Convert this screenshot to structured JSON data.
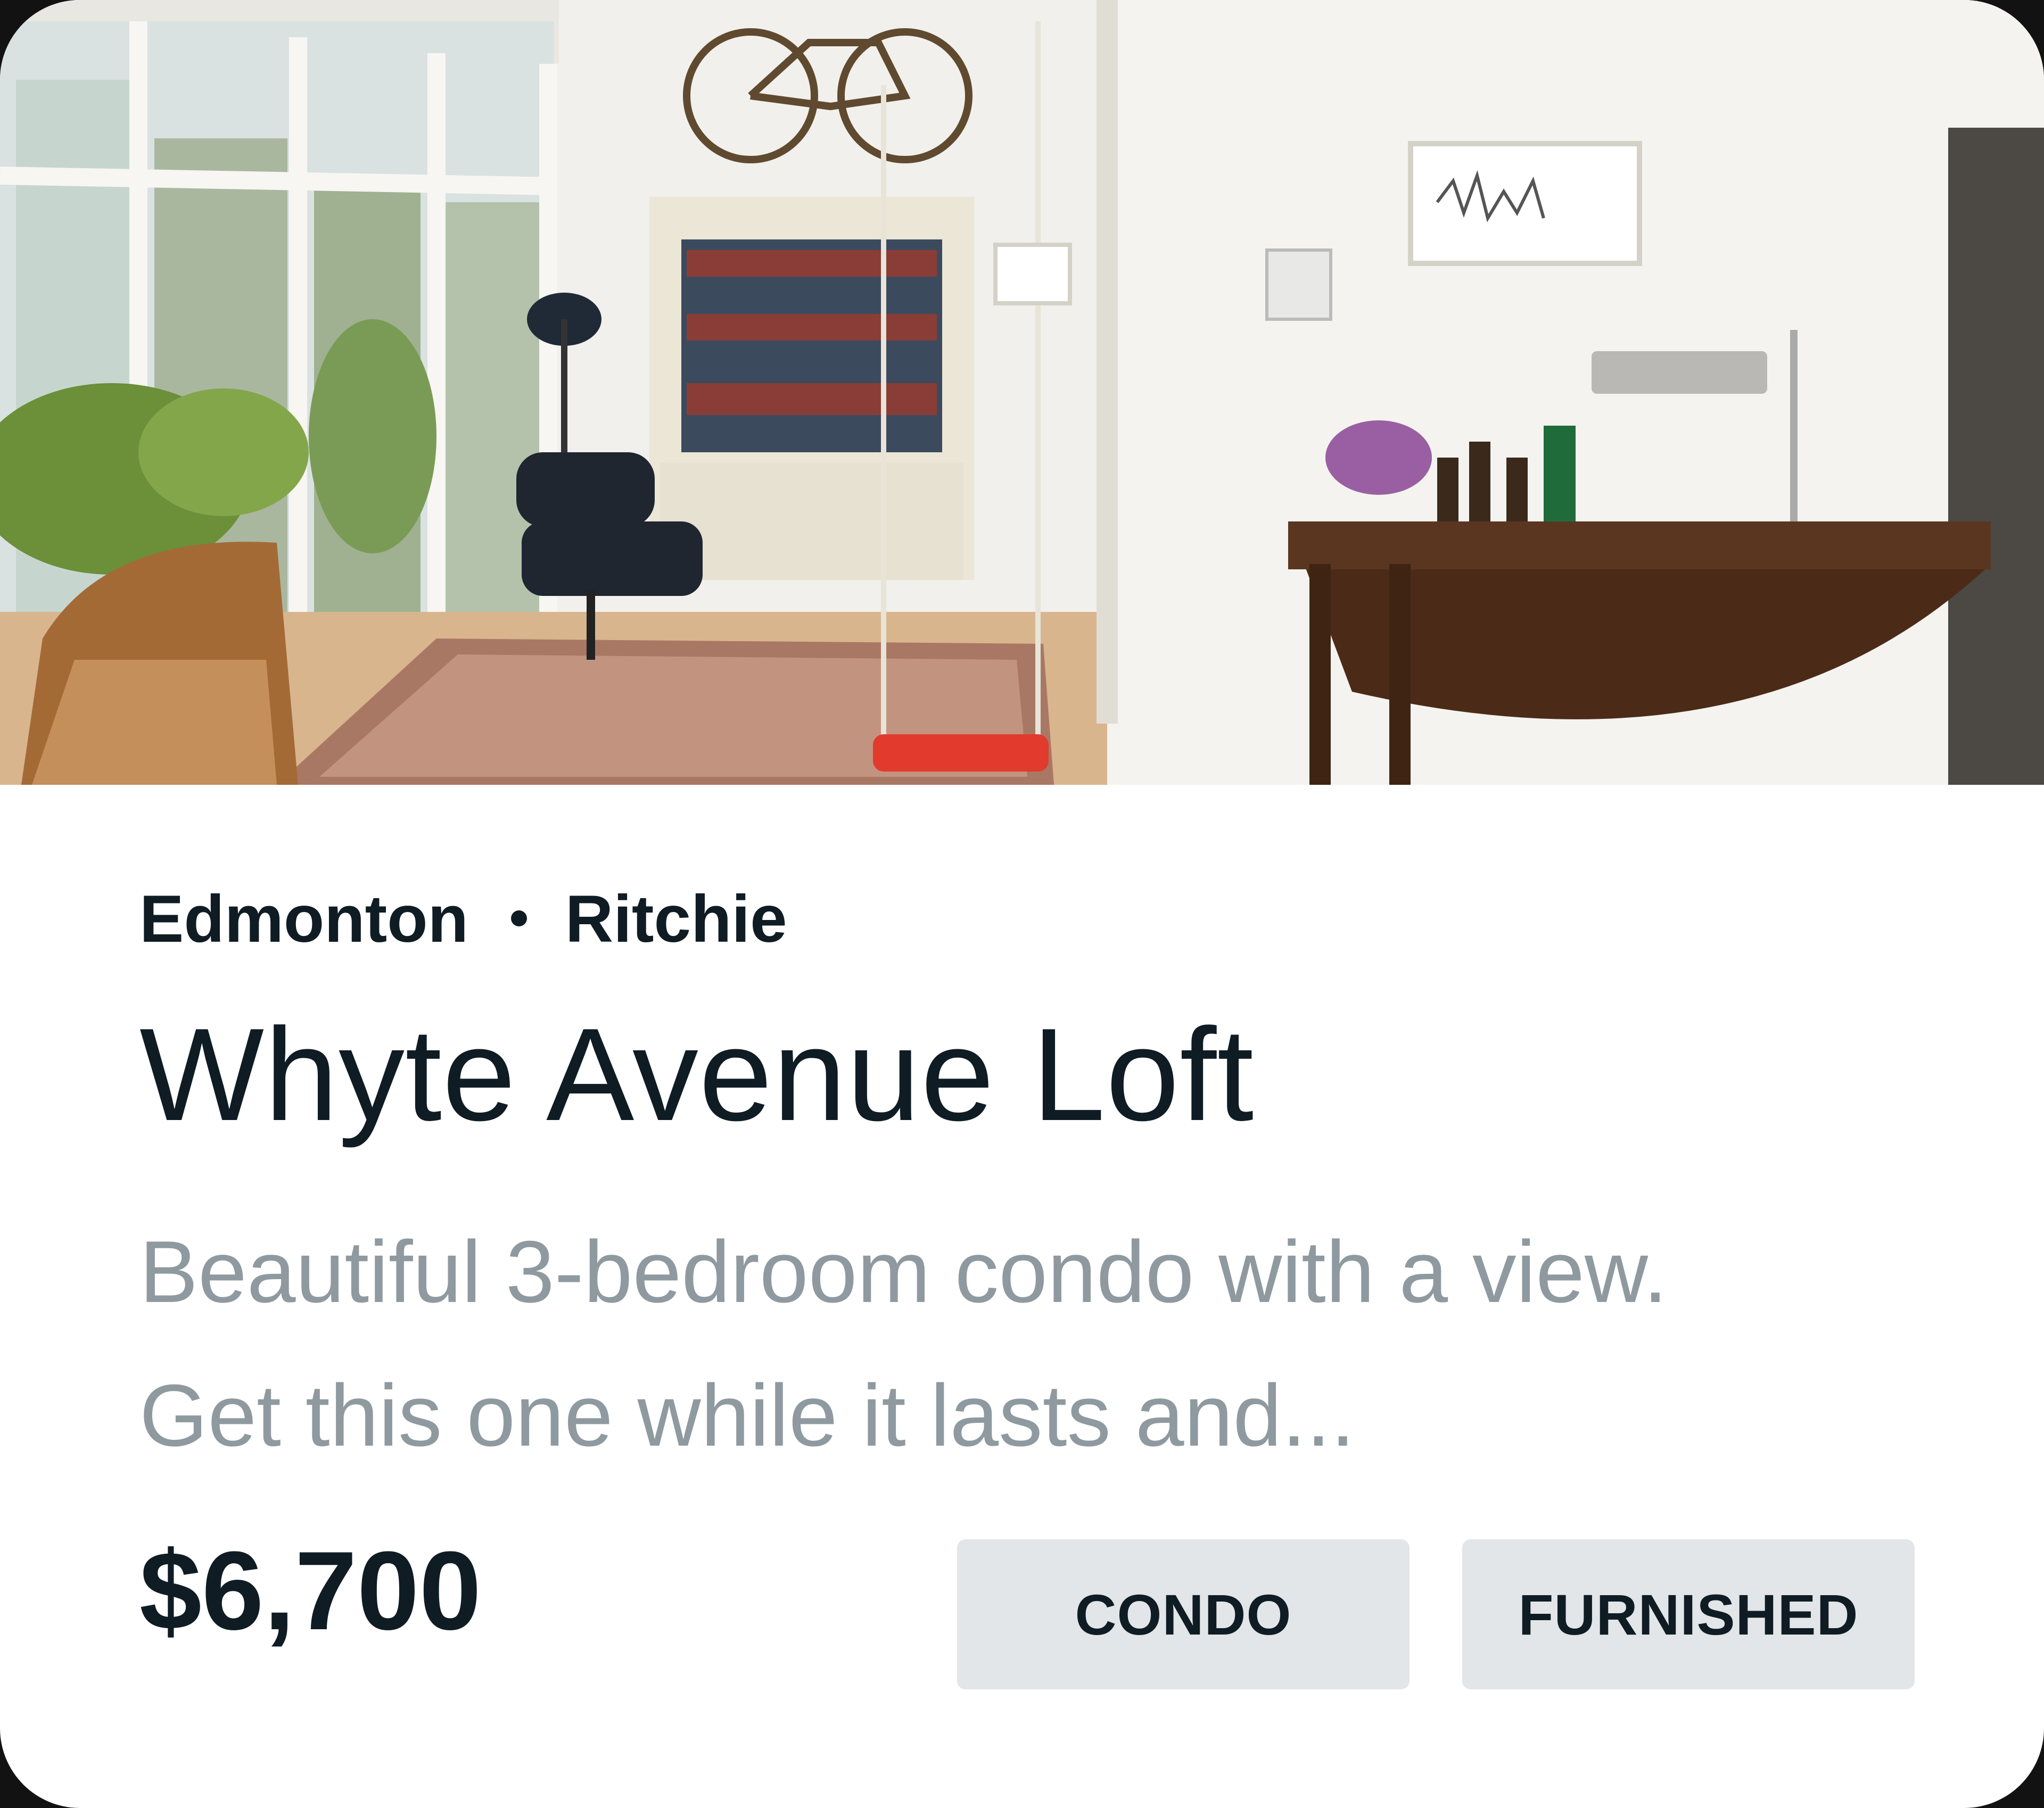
{
  "listing": {
    "city": "Edmonton",
    "neighborhood": "Ritchie",
    "title": "Whyte Avenue Loft",
    "description_line1": "Beautiful 3-bedroom condo with a view.",
    "description_line2": "Get this one while it lasts and...",
    "price": "$6,700",
    "tags": [
      "CONDO",
      "FURNISHED"
    ]
  },
  "photo": {
    "icon": "living-room-photo"
  },
  "colors": {
    "text_dark": "#0f1c24",
    "text_muted": "#8f9aa0",
    "chip_bg": "#e2e6e8",
    "card_bg": "#ffffff",
    "frame_bg": "#121212"
  }
}
